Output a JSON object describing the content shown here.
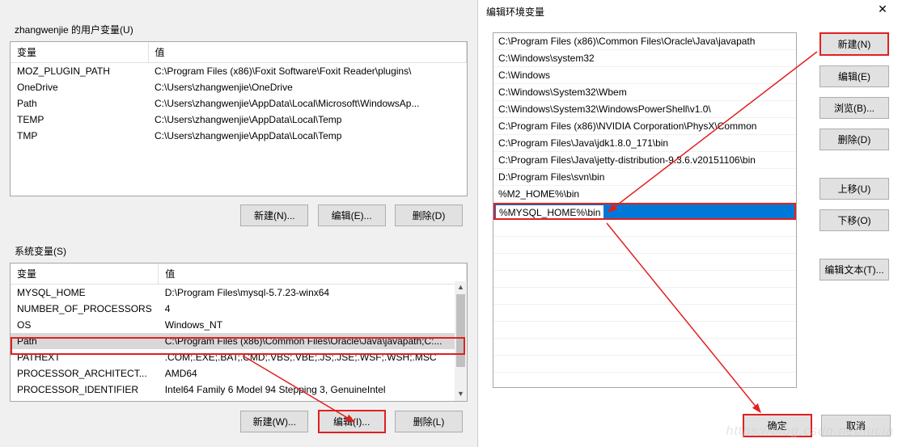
{
  "leftPanel": {
    "userVarsTitle": "zhangwenjie 的用户变量(U)",
    "sysVarsTitle": "系统变量(S)",
    "col_var": "变量",
    "col_val": "值",
    "userVars": [
      {
        "name": "MOZ_PLUGIN_PATH",
        "value": "C:\\Program Files (x86)\\Foxit Software\\Foxit Reader\\plugins\\"
      },
      {
        "name": "OneDrive",
        "value": "C:\\Users\\zhangwenjie\\OneDrive"
      },
      {
        "name": "Path",
        "value": "C:\\Users\\zhangwenjie\\AppData\\Local\\Microsoft\\WindowsAp..."
      },
      {
        "name": "TEMP",
        "value": "C:\\Users\\zhangwenjie\\AppData\\Local\\Temp"
      },
      {
        "name": "TMP",
        "value": "C:\\Users\\zhangwenjie\\AppData\\Local\\Temp"
      }
    ],
    "userBtn_new": "新建(N)...",
    "userBtn_edit": "编辑(E)...",
    "userBtn_del": "删除(D)",
    "sysVars": [
      {
        "name": "MYSQL_HOME",
        "value": "D:\\Program Files\\mysql-5.7.23-winx64"
      },
      {
        "name": "NUMBER_OF_PROCESSORS",
        "value": "4"
      },
      {
        "name": "OS",
        "value": "Windows_NT"
      },
      {
        "name": "Path",
        "value": "C:\\Program Files (x86)\\Common Files\\Oracle\\Java\\javapath;C:...",
        "selected": true
      },
      {
        "name": "PATHEXT",
        "value": ".COM;.EXE;.BAT;.CMD;.VBS;.VBE;.JS;.JSE;.WSF;.WSH;.MSC"
      },
      {
        "name": "PROCESSOR_ARCHITECT...",
        "value": "AMD64"
      },
      {
        "name": "PROCESSOR_IDENTIFIER",
        "value": "Intel64 Family 6 Model 94 Stepping 3, GenuineIntel"
      }
    ],
    "sysBtn_new": "新建(W)...",
    "sysBtn_edit": "编辑(I)...",
    "sysBtn_del": "删除(L)"
  },
  "rightPanel": {
    "title": "编辑环境变量",
    "pathItems": [
      "C:\\Program Files (x86)\\Common Files\\Oracle\\Java\\javapath",
      "C:\\Windows\\system32",
      "C:\\Windows",
      "C:\\Windows\\System32\\Wbem",
      "C:\\Windows\\System32\\WindowsPowerShell\\v1.0\\",
      "C:\\Program Files (x86)\\NVIDIA Corporation\\PhysX\\Common",
      "C:\\Program Files\\Java\\jdk1.8.0_171\\bin",
      "C:\\Program Files\\Java\\jetty-distribution-9.3.6.v20151106\\bin",
      "D:\\Program Files\\svn\\bin",
      "%M2_HOME%\\bin"
    ],
    "editing": "%MYSQL_HOME%\\bin",
    "btn_new": "新建(N)",
    "btn_edit": "编辑(E)",
    "btn_browse": "浏览(B)...",
    "btn_del": "删除(D)",
    "btn_up": "上移(U)",
    "btn_down": "下移(O)",
    "btn_editText": "编辑文本(T)...",
    "btn_ok": "确定",
    "btn_cancel": "取消"
  },
  "watermark": "https://blog.csdn.net/lucia"
}
